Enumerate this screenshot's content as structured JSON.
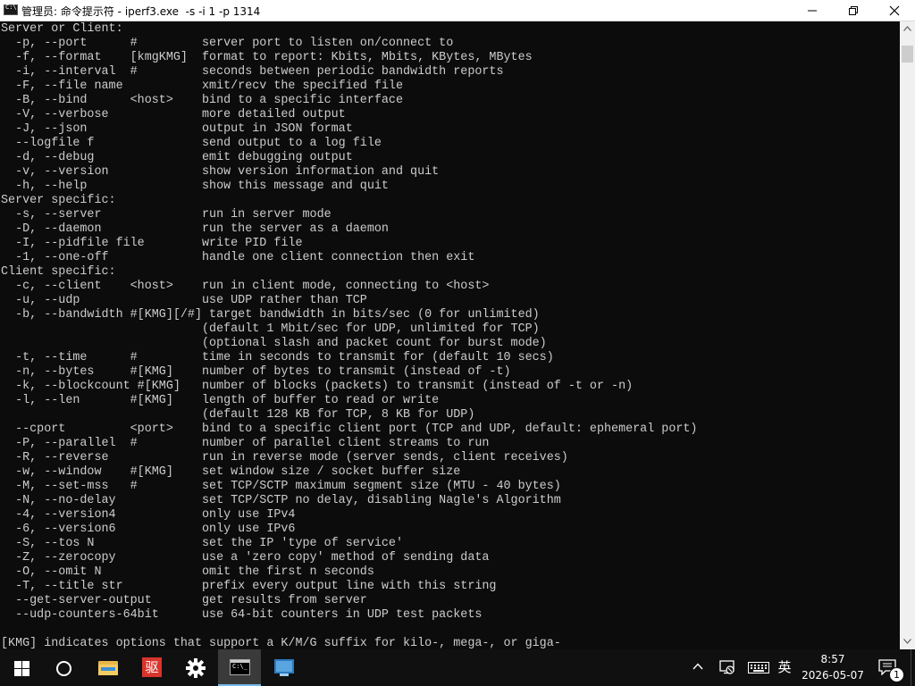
{
  "window": {
    "title": "管理员: 命令提示符 - iperf3.exe  -s -i 1 -p 1314"
  },
  "console": {
    "lines": [
      "Server or Client:",
      "  -p, --port      #         server port to listen on/connect to",
      "  -f, --format    [kmgKMG]  format to report: Kbits, Mbits, KBytes, MBytes",
      "  -i, --interval  #         seconds between periodic bandwidth reports",
      "  -F, --file name           xmit/recv the specified file",
      "  -B, --bind      <host>    bind to a specific interface",
      "  -V, --verbose             more detailed output",
      "  -J, --json                output in JSON format",
      "  --logfile f               send output to a log file",
      "  -d, --debug               emit debugging output",
      "  -v, --version             show version information and quit",
      "  -h, --help                show this message and quit",
      "Server specific:",
      "  -s, --server              run in server mode",
      "  -D, --daemon              run the server as a daemon",
      "  -I, --pidfile file        write PID file",
      "  -1, --one-off             handle one client connection then exit",
      "Client specific:",
      "  -c, --client    <host>    run in client mode, connecting to <host>",
      "  -u, --udp                 use UDP rather than TCP",
      "  -b, --bandwidth #[KMG][/#] target bandwidth in bits/sec (0 for unlimited)",
      "                            (default 1 Mbit/sec for UDP, unlimited for TCP)",
      "                            (optional slash and packet count for burst mode)",
      "  -t, --time      #         time in seconds to transmit for (default 10 secs)",
      "  -n, --bytes     #[KMG]    number of bytes to transmit (instead of -t)",
      "  -k, --blockcount #[KMG]   number of blocks (packets) to transmit (instead of -t or -n)",
      "  -l, --len       #[KMG]    length of buffer to read or write",
      "                            (default 128 KB for TCP, 8 KB for UDP)",
      "  --cport         <port>    bind to a specific client port (TCP and UDP, default: ephemeral port)",
      "  -P, --parallel  #         number of parallel client streams to run",
      "  -R, --reverse             run in reverse mode (server sends, client receives)",
      "  -w, --window    #[KMG]    set window size / socket buffer size",
      "  -M, --set-mss   #         set TCP/SCTP maximum segment size (MTU - 40 bytes)",
      "  -N, --no-delay            set TCP/SCTP no delay, disabling Nagle's Algorithm",
      "  -4, --version4            only use IPv4",
      "  -6, --version6            only use IPv6",
      "  -S, --tos N               set the IP 'type of service'",
      "  -Z, --zerocopy            use a 'zero copy' method of sending data",
      "  -O, --omit N              omit the first n seconds",
      "  -T, --title str           prefix every output line with this string",
      "  --get-server-output       get results from server",
      "  --udp-counters-64bit      use 64-bit counters in UDP test packets",
      "",
      "[KMG] indicates options that support a K/M/G suffix for kilo-, mega-, or giga-"
    ],
    "fg_color": "#cccccc",
    "bg_color": "#0c0c0c"
  },
  "taskbar": {
    "red_app_glyph": "驱",
    "cmd_glyph": "C:\\_",
    "ime_label": "英",
    "time": "8:57",
    "date": "2026-05-07",
    "notification_count": "1",
    "accent": "#76b9ed"
  }
}
